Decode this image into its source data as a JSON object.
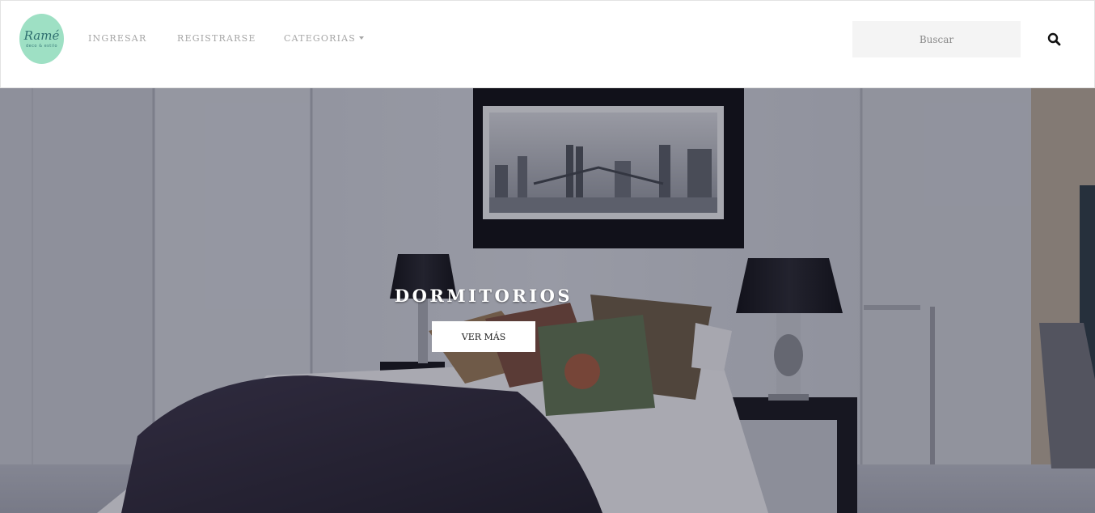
{
  "header": {
    "logo": {
      "text": "Ramé",
      "subtext": "deco & estilo"
    },
    "nav": {
      "ingresar": "INGRESAR",
      "registrarse": "REGISTRARSE",
      "categorias": "CATEGORIAS"
    },
    "search": {
      "placeholder": "Buscar",
      "icon": "search-icon"
    }
  },
  "hero": {
    "title": "DORMITORIOS",
    "button_label": "VER MÁS"
  },
  "colors": {
    "logo_bg": "#9ee0c4",
    "nav_text": "#a6a6a6",
    "search_bg": "#f4f4f4",
    "hero_overlay": "#1c1c30"
  }
}
